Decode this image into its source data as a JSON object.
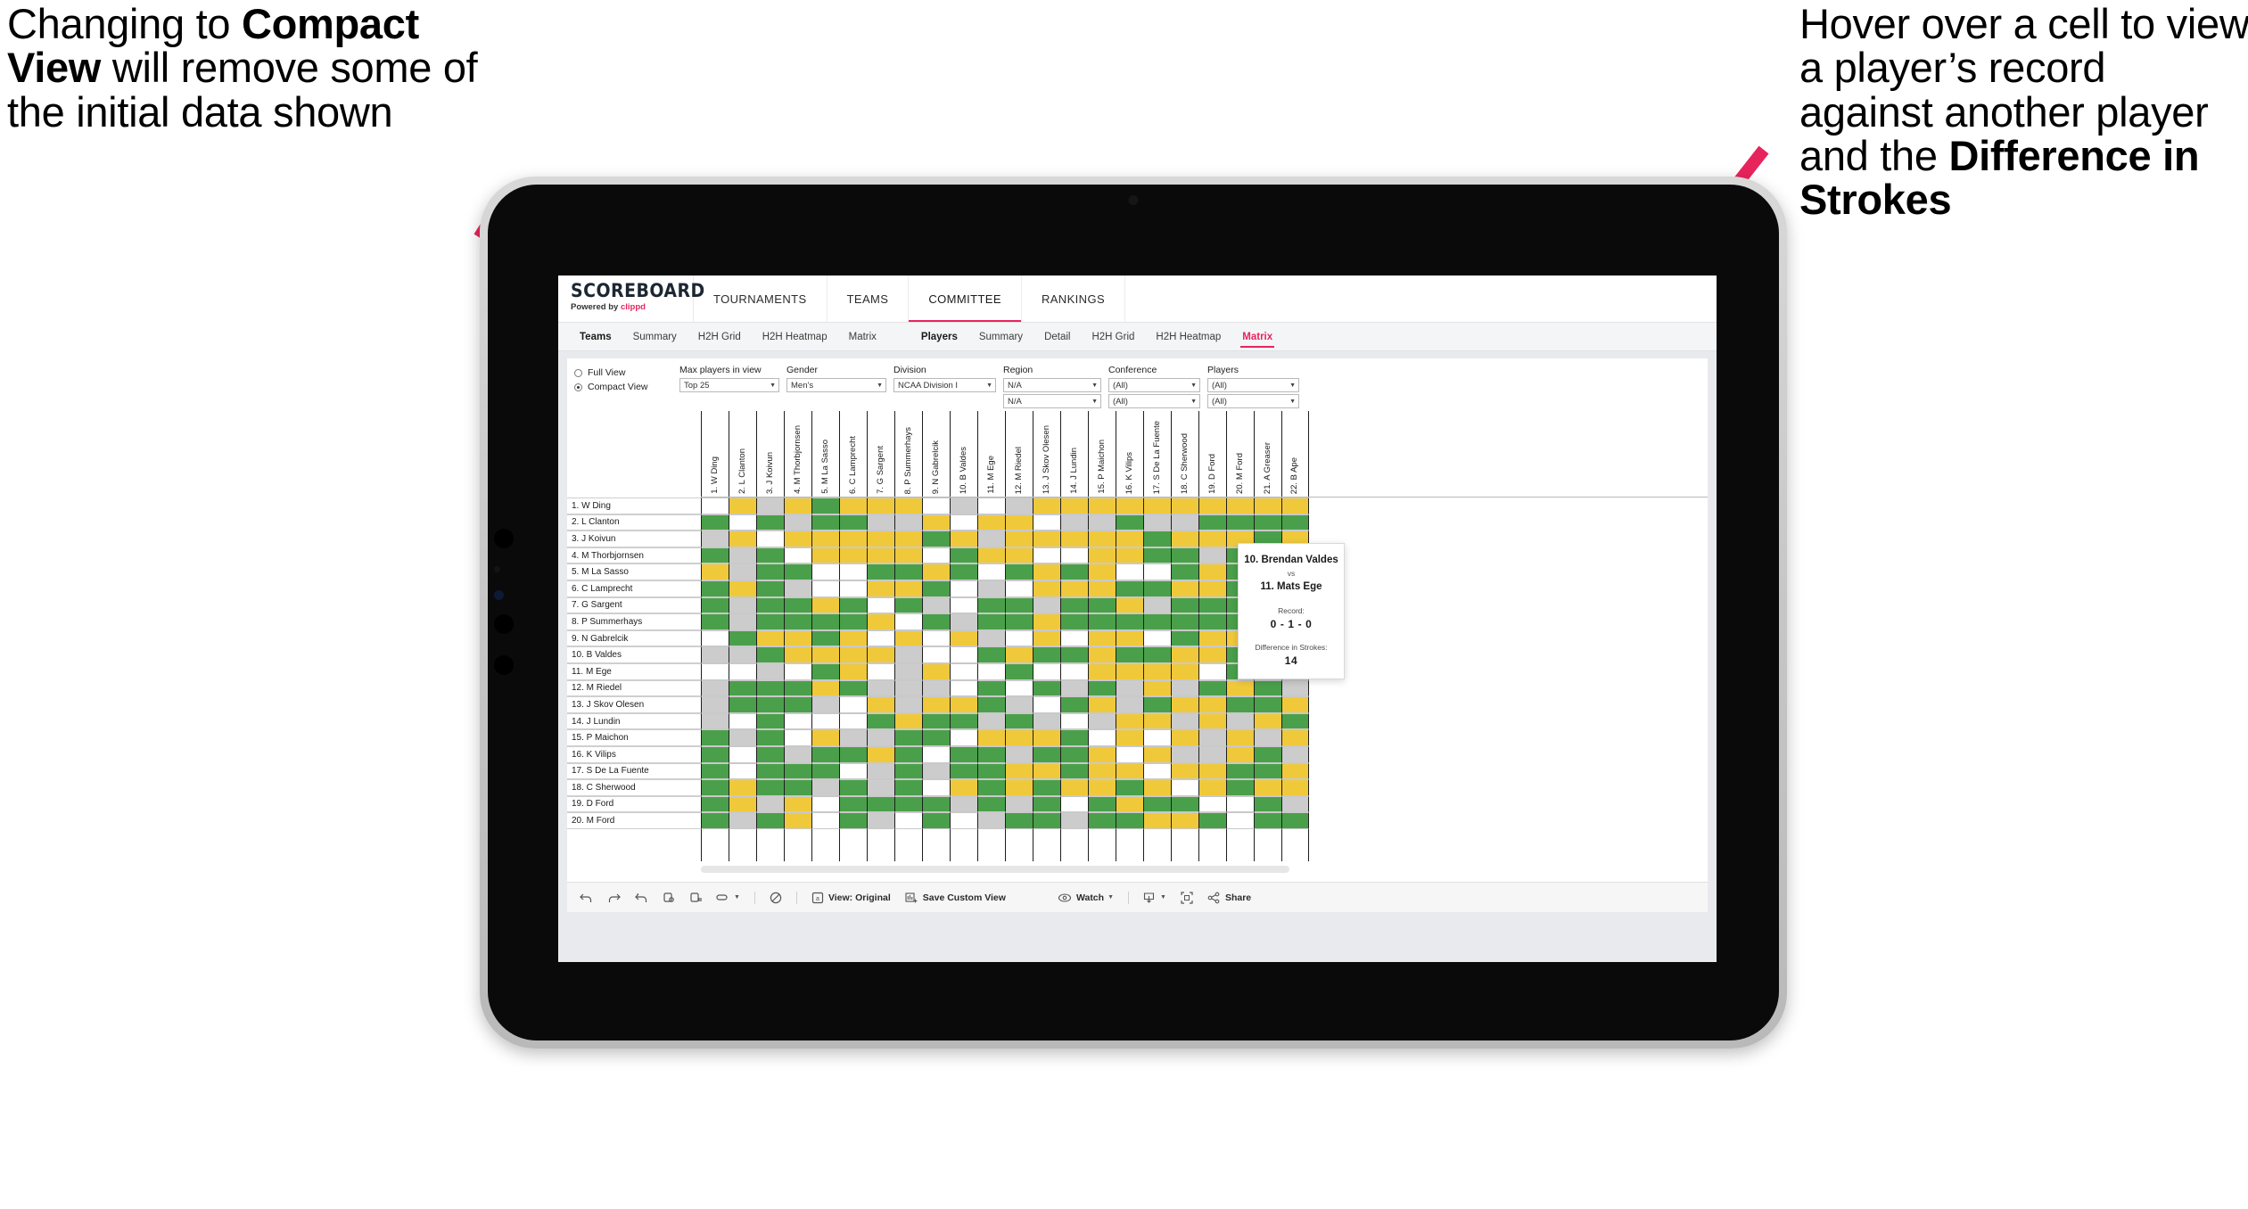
{
  "annotations": {
    "left": {
      "pre": "Changing to ",
      "bold": "Compact View",
      "post": " will remove some of the initial data shown"
    },
    "right": {
      "pre": "Hover over a cell to view a player’s record against another player and the ",
      "bold": "Difference in Strokes",
      "post": ""
    }
  },
  "brand": {
    "name": "SCOREBOARD",
    "sub_pre": "Powered by ",
    "sub_brand": "clippd"
  },
  "topnav": [
    {
      "label": "TOURNAMENTS",
      "active": false
    },
    {
      "label": "TEAMS",
      "active": false
    },
    {
      "label": "COMMITTEE",
      "active": true
    },
    {
      "label": "RANKINGS",
      "active": false
    }
  ],
  "subnav": {
    "teams_group": [
      "Teams",
      "Summary",
      "H2H Grid",
      "H2H Heatmap",
      "Matrix"
    ],
    "players_group": [
      "Players",
      "Summary",
      "Detail",
      "H2H Grid",
      "H2H Heatmap",
      "Matrix"
    ],
    "active": "Matrix"
  },
  "filters": {
    "view_options": [
      {
        "label": "Full View",
        "selected": false
      },
      {
        "label": "Compact View",
        "selected": true
      }
    ],
    "fields": [
      {
        "label": "Max players in view",
        "values": [
          "Top 25"
        ],
        "width": "w-max"
      },
      {
        "label": "Gender",
        "values": [
          "Men’s"
        ],
        "width": "w-gen"
      },
      {
        "label": "Division",
        "values": [
          "NCAA Division I"
        ],
        "width": "w-div"
      },
      {
        "label": "Region",
        "values": [
          "N/A",
          "N/A"
        ],
        "width": "w-reg"
      },
      {
        "label": "Conference",
        "values": [
          "(All)",
          "(All)"
        ],
        "width": "w-con"
      },
      {
        "label": "Players",
        "values": [
          "(All)",
          "(All)"
        ],
        "width": "w-ply"
      }
    ]
  },
  "matrix": {
    "columns": [
      "1. W Ding",
      "2. L Clanton",
      "3. J Koivun",
      "4. M Thorbjornsen",
      "5. M La Sasso",
      "6. C Lamprecht",
      "7. G Sargent",
      "8. P Summerhays",
      "9. N Gabrelcik",
      "10. B Valdes",
      "11. M Ege",
      "12. M Riedel",
      "13. J Skov Olesen",
      "14. J Lundin",
      "15. P Maichon",
      "16. K Vilips",
      "17. S De La Fuente",
      "18. C Sherwood",
      "19. D Ford",
      "20. M Ford",
      "21. A Greaser",
      "22. B Ape"
    ],
    "rows": [
      "1. W Ding",
      "2. L Clanton",
      "3. J Koivun",
      "4. M Thorbjornsen",
      "5. M La Sasso",
      "6. C Lamprecht",
      "7. G Sargent",
      "8. P Summerhays",
      "9. N Gabrelcik",
      "10. B Valdes",
      "11. M Ege",
      "12. M Riedel",
      "13. J Skov Olesen",
      "14. J Lundin",
      "15. P Maichon",
      "16. K Vilips",
      "17. S De La Fuente",
      "18. C Sherwood",
      "19. D Ford",
      "20. M Ford"
    ],
    "legend_colors": {
      "win": "#4aa04a",
      "tie": "#f0c93b",
      "loss": "#cccccc",
      "none": "#ffffff"
    },
    "cells": [
      [
        "w",
        "y",
        "s",
        "y",
        "g",
        "y",
        "y",
        "y",
        "w",
        "s",
        "w",
        "s",
        "y",
        "y",
        "y",
        "y",
        "y",
        "y",
        "y",
        "y",
        "y",
        "y"
      ],
      [
        "g",
        "w",
        "g",
        "s",
        "g",
        "g",
        "s",
        "s",
        "y",
        "w",
        "y",
        "y",
        "w",
        "s",
        "s",
        "g",
        "s",
        "s",
        "g",
        "g",
        "g",
        "g"
      ],
      [
        "s",
        "y",
        "w",
        "y",
        "y",
        "y",
        "y",
        "y",
        "g",
        "y",
        "s",
        "y",
        "y",
        "y",
        "y",
        "y",
        "g",
        "y",
        "y",
        "y",
        "g",
        "y"
      ],
      [
        "g",
        "s",
        "g",
        "w",
        "y",
        "y",
        "y",
        "y",
        "w",
        "g",
        "y",
        "y",
        "w",
        "w",
        "y",
        "y",
        "g",
        "g",
        "s",
        "g",
        "y",
        "y"
      ],
      [
        "y",
        "s",
        "g",
        "g",
        "w",
        "w",
        "g",
        "g",
        "y",
        "g",
        "w",
        "g",
        "y",
        "g",
        "y",
        "w",
        "w",
        "g",
        "y",
        "g",
        "y",
        "g"
      ],
      [
        "g",
        "y",
        "g",
        "s",
        "w",
        "w",
        "y",
        "y",
        "g",
        "w",
        "s",
        "w",
        "y",
        "y",
        "y",
        "g",
        "g",
        "y",
        "y",
        "g",
        "y",
        "y"
      ],
      [
        "g",
        "s",
        "g",
        "g",
        "y",
        "g",
        "w",
        "g",
        "s",
        "w",
        "g",
        "g",
        "s",
        "g",
        "g",
        "y",
        "s",
        "g",
        "g",
        "g",
        "g",
        "g"
      ],
      [
        "g",
        "s",
        "g",
        "g",
        "g",
        "g",
        "y",
        "w",
        "g",
        "s",
        "g",
        "g",
        "y",
        "g",
        "g",
        "g",
        "g",
        "g",
        "g",
        "g",
        "g",
        "g"
      ],
      [
        "w",
        "g",
        "y",
        "y",
        "g",
        "y",
        "w",
        "y",
        "w",
        "y",
        "s",
        "w",
        "y",
        "w",
        "y",
        "y",
        "w",
        "g",
        "y",
        "y",
        "y",
        "g"
      ],
      [
        "s",
        "s",
        "g",
        "y",
        "y",
        "y",
        "y",
        "s",
        "w",
        "w",
        "g",
        "y",
        "g",
        "g",
        "y",
        "g",
        "g",
        "y",
        "y",
        "g",
        "s",
        "y"
      ],
      [
        "w",
        "w",
        "s",
        "w",
        "g",
        "y",
        "w",
        "s",
        "y",
        "w",
        "w",
        "g",
        "w",
        "w",
        "y",
        "y",
        "y",
        "y",
        "w",
        "g",
        "y",
        "y"
      ],
      [
        "s",
        "g",
        "g",
        "g",
        "y",
        "g",
        "s",
        "s",
        "s",
        "w",
        "g",
        "w",
        "g",
        "s",
        "g",
        "s",
        "y",
        "s",
        "g",
        "y",
        "g",
        "s"
      ],
      [
        "s",
        "g",
        "g",
        "g",
        "s",
        "w",
        "y",
        "s",
        "y",
        "y",
        "g",
        "s",
        "w",
        "g",
        "y",
        "s",
        "g",
        "y",
        "y",
        "g",
        "g",
        "y"
      ],
      [
        "s",
        "w",
        "g",
        "w",
        "w",
        "w",
        "g",
        "y",
        "g",
        "g",
        "s",
        "g",
        "s",
        "w",
        "s",
        "y",
        "y",
        "s",
        "y",
        "s",
        "y",
        "g"
      ],
      [
        "g",
        "s",
        "g",
        "w",
        "y",
        "s",
        "s",
        "g",
        "g",
        "w",
        "y",
        "y",
        "y",
        "g",
        "w",
        "y",
        "w",
        "y",
        "s",
        "y",
        "s",
        "y"
      ],
      [
        "g",
        "w",
        "g",
        "s",
        "g",
        "g",
        "y",
        "g",
        "w",
        "g",
        "g",
        "s",
        "g",
        "g",
        "y",
        "w",
        "y",
        "s",
        "s",
        "y",
        "g",
        "s"
      ],
      [
        "g",
        "w",
        "g",
        "g",
        "g",
        "w",
        "s",
        "g",
        "s",
        "g",
        "g",
        "y",
        "y",
        "g",
        "y",
        "y",
        "w",
        "y",
        "y",
        "g",
        "g",
        "y"
      ],
      [
        "g",
        "y",
        "g",
        "g",
        "s",
        "g",
        "s",
        "g",
        "w",
        "y",
        "g",
        "y",
        "g",
        "y",
        "y",
        "g",
        "y",
        "w",
        "y",
        "g",
        "y",
        "y"
      ],
      [
        "g",
        "y",
        "s",
        "y",
        "w",
        "g",
        "g",
        "g",
        "g",
        "s",
        "g",
        "s",
        "g",
        "w",
        "g",
        "y",
        "g",
        "g",
        "w",
        "w",
        "g",
        "s"
      ],
      [
        "g",
        "s",
        "g",
        "y",
        "w",
        "g",
        "s",
        "w",
        "g",
        "w",
        "s",
        "g",
        "g",
        "s",
        "g",
        "g",
        "y",
        "y",
        "g",
        "w",
        "g",
        "g"
      ]
    ]
  },
  "tooltip": {
    "player_a": "10. Brendan Valdes",
    "vs": "vs",
    "player_b": "11. Mats Ege",
    "record_label": "Record:",
    "record_value": "0 - 1 - 0",
    "strokes_label": "Difference in Strokes:",
    "strokes_value": "14"
  },
  "bottombar": {
    "view_label": "View: Original",
    "save_label": "Save Custom View",
    "watch_label": "Watch",
    "share_label": "Share"
  },
  "colors": {
    "accent": "#e8245c",
    "green": "#4aa04a",
    "yellow": "#f0c93b",
    "grey": "#cccccc"
  }
}
